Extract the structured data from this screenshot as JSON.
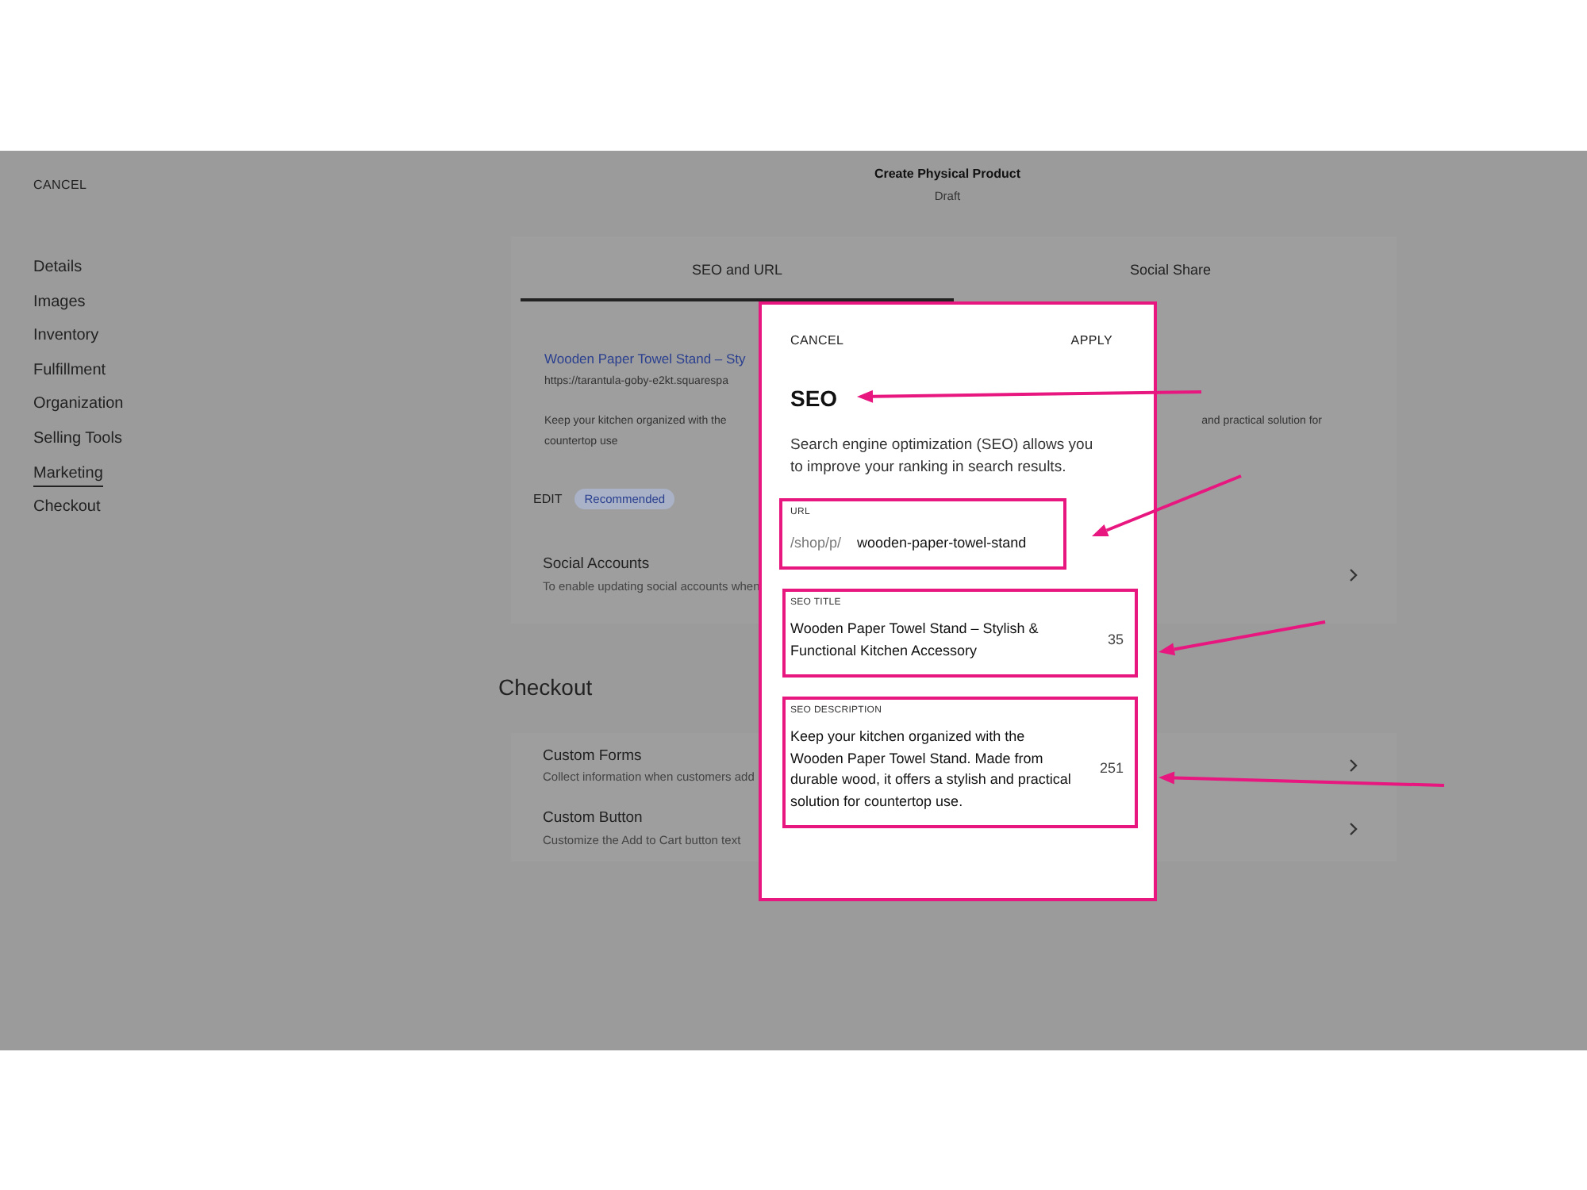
{
  "header": {
    "cancel": "CANCEL",
    "title": "Create Physical Product",
    "subtitle": "Draft"
  },
  "sidebar": {
    "items": [
      {
        "label": "Details",
        "selected": false
      },
      {
        "label": "Images",
        "selected": false
      },
      {
        "label": "Inventory",
        "selected": false
      },
      {
        "label": "Fulfillment",
        "selected": false
      },
      {
        "label": "Organization",
        "selected": false
      },
      {
        "label": "Selling Tools",
        "selected": false
      },
      {
        "label": "Marketing",
        "selected": true
      },
      {
        "label": "Checkout",
        "selected": false
      }
    ]
  },
  "tabs": [
    {
      "label": "SEO and URL",
      "selected": true
    },
    {
      "label": "Social Share",
      "selected": false
    }
  ],
  "preview": {
    "title": "Wooden Paper Towel Stand – Sty",
    "url": "https://tarantula-goby-e2kt.squarespa",
    "description_left": "Keep your kitchen organized with the",
    "description_right": "and practical solution for",
    "description_line2": "countertop use",
    "edit": "EDIT",
    "badge": "Recommended"
  },
  "marketing_rows": [
    {
      "title": "Social Accounts",
      "subtitle": "To enable updating social accounts when"
    }
  ],
  "checkout": {
    "heading": "Checkout",
    "rows": [
      {
        "title": "Custom Forms",
        "subtitle": "Collect information when customers add"
      },
      {
        "title": "Custom Button",
        "subtitle": "Customize the Add to Cart button text"
      }
    ]
  },
  "modal": {
    "cancel": "CANCEL",
    "apply": "APPLY",
    "heading": "SEO",
    "description": "Search engine optimization (SEO) allows you to improve your ranking in search results.",
    "fields": [
      {
        "kind": "url",
        "label": "URL",
        "prefix": "/shop/p/",
        "value": "wooden-paper-towel-stand"
      },
      {
        "kind": "text",
        "label": "SEO TITLE",
        "value": "Wooden Paper Towel Stand – Stylish & Functional Kitchen Accessory",
        "count": "35"
      },
      {
        "kind": "text",
        "label": "SEO DESCRIPTION",
        "value": "Keep your kitchen organized with the Wooden Paper Towel Stand. Made from durable wood, it offers a stylish and practical solution for countertop use.",
        "count": "251"
      }
    ]
  }
}
